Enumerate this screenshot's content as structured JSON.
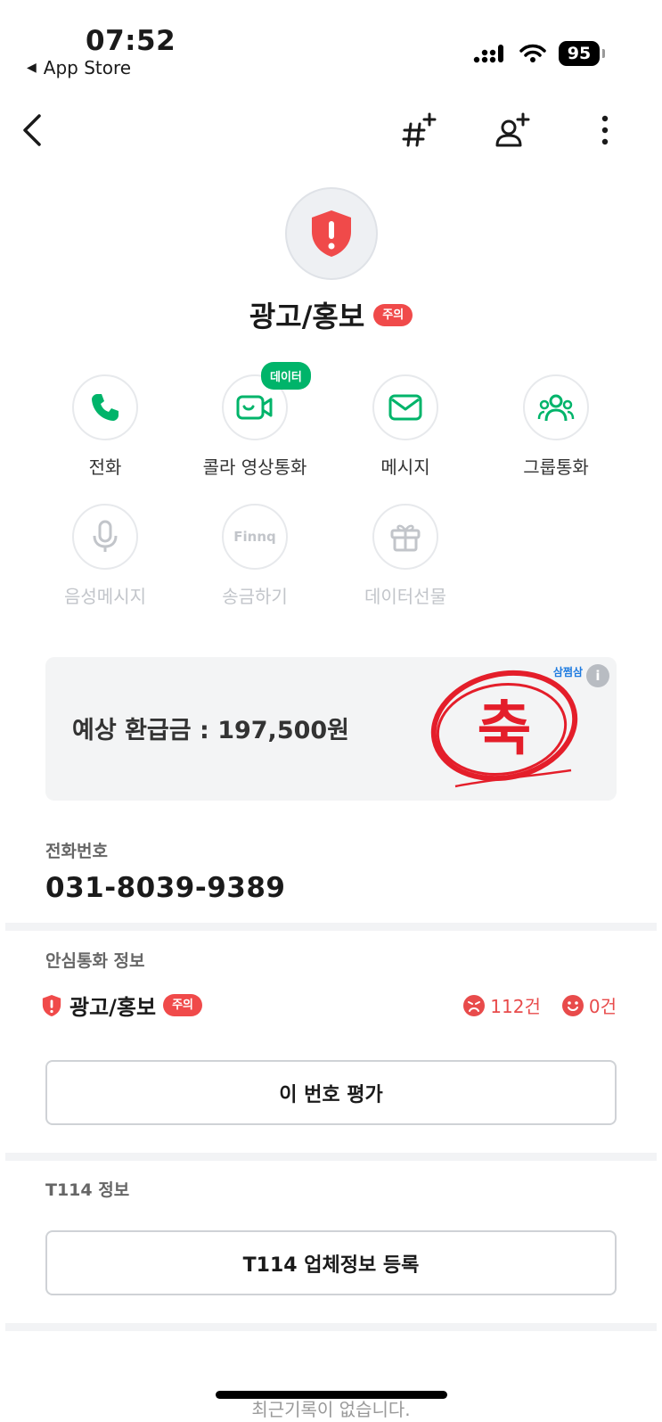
{
  "status_bar": {
    "time": "07:52",
    "back_app": "App Store",
    "battery": "95"
  },
  "icons": {
    "back": "chevron-left-icon",
    "add_tag": "hashtag-plus-icon",
    "add_contact": "person-plus-icon",
    "more": "more-vertical-icon"
  },
  "profile": {
    "name": "광고/홍보",
    "badge": "주의"
  },
  "actions": [
    {
      "label": "전화",
      "icon": "phone-icon",
      "enabled": true
    },
    {
      "label": "콜라 영상통화",
      "icon": "video-call-icon",
      "enabled": true,
      "badge": "데이터"
    },
    {
      "label": "메시지",
      "icon": "message-icon",
      "enabled": true
    },
    {
      "label": "그룹통화",
      "icon": "group-call-icon",
      "enabled": true
    },
    {
      "label": "음성메시지",
      "icon": "microphone-icon",
      "enabled": false
    },
    {
      "label": "송금하기",
      "icon": "finnq-icon",
      "enabled": false,
      "glyph": "Finnq"
    },
    {
      "label": "데이터선물",
      "icon": "gift-icon",
      "enabled": false
    }
  ],
  "ad": {
    "text": "예상 환급금 : 197,500원",
    "brand": "삼쩜삼",
    "info": "i",
    "stamp_text": "축"
  },
  "phone_section": {
    "label": "전화번호",
    "number": "031-8039-9389"
  },
  "safe_call": {
    "label": "안심통화 정보",
    "category": "광고/홍보",
    "badge": "주의",
    "negative_count": "112건",
    "positive_count": "0건",
    "rate_button": "이 번호 평가"
  },
  "t114": {
    "label": "T114 정보",
    "register_button": "T114 업체정보 등록"
  },
  "recent": {
    "empty_text": "최근기록이 없습니다."
  },
  "colors": {
    "warning_red": "#f04a4a",
    "green_accent": "#00b46a",
    "stat_red": "#e84b4b"
  }
}
